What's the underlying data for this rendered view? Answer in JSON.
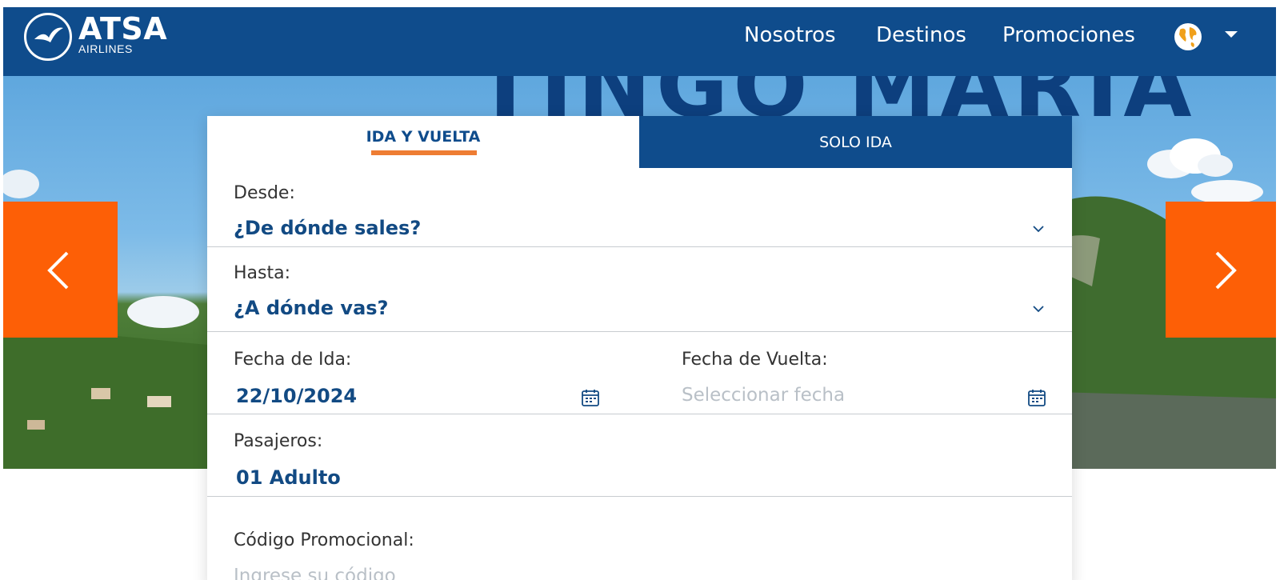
{
  "header": {
    "logo_title": "ATSA",
    "logo_subtitle": "AIRLINES",
    "nav": [
      "Nosotros",
      "Destinos",
      "Promociones"
    ],
    "language_icon": "globe-icon"
  },
  "hero": {
    "title": "TINGO MARIA",
    "prev_icon": "chevron-left-icon",
    "next_icon": "chevron-right-icon"
  },
  "booking": {
    "tabs": [
      {
        "label": "IDA Y VUELTA",
        "active": true
      },
      {
        "label": "SOLO IDA",
        "active": false
      }
    ],
    "from": {
      "label": "Desde:",
      "value": "¿De dónde sales?"
    },
    "to": {
      "label": "Hasta:",
      "value": "¿A dónde vas?"
    },
    "depart": {
      "label": "Fecha de Ida:",
      "value": "22/10/2024"
    },
    "return": {
      "label": "Fecha de Vuelta:",
      "placeholder": "Seleccionar fecha"
    },
    "passengers": {
      "label": "Pasajeros:",
      "value": "01 Adulto"
    },
    "promo": {
      "label": "Código Promocional:",
      "placeholder": "Ingrese su código"
    }
  },
  "colors": {
    "brand_blue": "#0f4c8c",
    "accent_orange": "#fd5f06",
    "tab_underline": "#ee7d33"
  }
}
